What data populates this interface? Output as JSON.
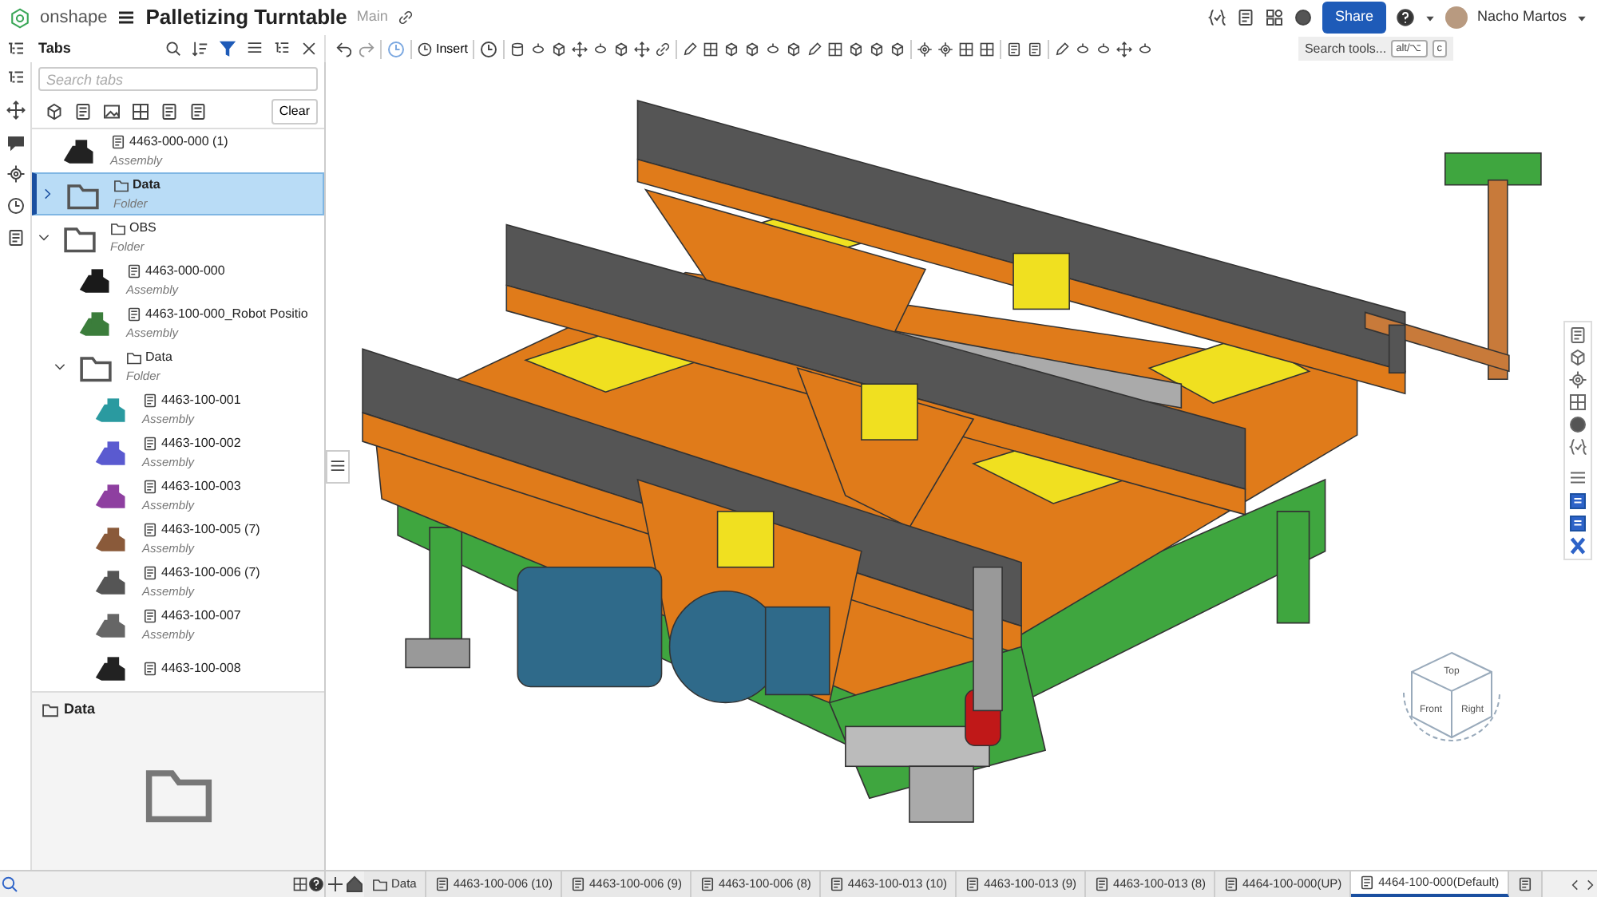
{
  "app": {
    "logo": "onshape"
  },
  "document": {
    "title": "Palletizing Turntable",
    "branch": "Main"
  },
  "header": {
    "share": "Share",
    "user": "Nacho Martos"
  },
  "panel": {
    "title": "Tabs",
    "search": {
      "placeholder": "Search tabs"
    },
    "clear": "Clear",
    "items": [
      {
        "kind": "assembly",
        "name": "4463-000-000 (1)",
        "type": "Assembly",
        "selected": false
      },
      {
        "kind": "folder",
        "name": "Data",
        "type": "Folder",
        "selected": true,
        "expanded": false
      },
      {
        "kind": "folder",
        "name": "OBS",
        "type": "Folder",
        "selected": false,
        "expanded": true,
        "children": [
          {
            "kind": "assembly",
            "name": "4463-000-000",
            "type": "Assembly",
            "selected": false
          },
          {
            "kind": "assembly",
            "name": "4463-100-000_Robot Positio",
            "type": "Assembly",
            "selected": false
          },
          {
            "kind": "folder",
            "name": "Data",
            "type": "Folder",
            "selected": false,
            "expanded": true,
            "children": [
              {
                "kind": "assembly",
                "name": "4463-100-001",
                "type": "Assembly",
                "selected": false
              },
              {
                "kind": "assembly",
                "name": "4463-100-002",
                "type": "Assembly",
                "selected": false
              },
              {
                "kind": "assembly",
                "name": "4463-100-003",
                "type": "Assembly",
                "selected": false
              },
              {
                "kind": "assembly",
                "name": "4463-100-005 (7)",
                "type": "Assembly",
                "selected": false
              },
              {
                "kind": "assembly",
                "name": "4463-100-006 (7)",
                "type": "Assembly",
                "selected": false
              },
              {
                "kind": "assembly",
                "name": "4463-100-007",
                "type": "Assembly",
                "selected": false
              },
              {
                "kind": "assembly",
                "name": "4463-100-008",
                "selected": false
              }
            ]
          }
        ]
      }
    ],
    "preview": {
      "title": "Data"
    }
  },
  "toolbar": {
    "insert": "Insert",
    "search": {
      "placeholder": "Search tools...",
      "keys": [
        "alt/⌥",
        "c"
      ]
    }
  },
  "viewcube": {
    "faces": [
      "Top",
      "Front",
      "Right"
    ]
  },
  "tabs": [
    {
      "kind": "folder",
      "label": "Data",
      "selected": false
    },
    {
      "kind": "assembly",
      "label": "4463-100-006 (10)",
      "selected": false
    },
    {
      "kind": "assembly",
      "label": "4463-100-006 (9)",
      "selected": false
    },
    {
      "kind": "assembly",
      "label": "4463-100-006 (8)",
      "selected": false
    },
    {
      "kind": "assembly",
      "label": "4463-100-013 (10)",
      "selected": false
    },
    {
      "kind": "assembly",
      "label": "4463-100-013 (9)",
      "selected": false
    },
    {
      "kind": "assembly",
      "label": "4463-100-013 (8)",
      "selected": false
    },
    {
      "kind": "assembly",
      "label": "4464-100-000(UP)",
      "selected": false
    },
    {
      "kind": "assembly",
      "label": "4464-100-000(Default)",
      "selected": true
    },
    {
      "kind": "assembly",
      "selected": false
    }
  ]
}
